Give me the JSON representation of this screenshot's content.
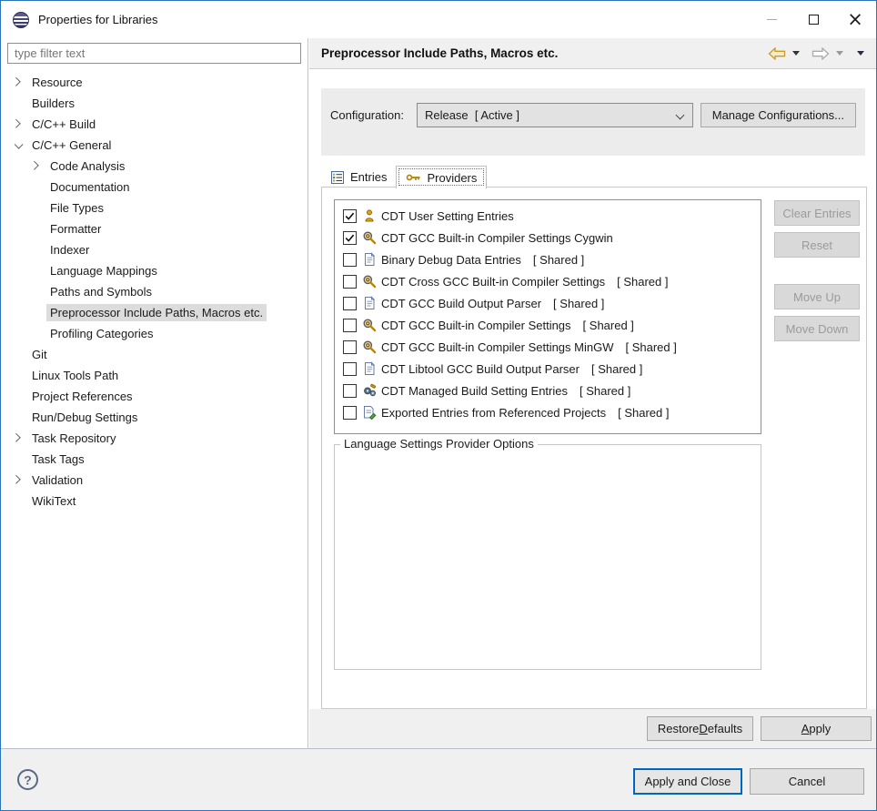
{
  "window": {
    "title": "Properties for Libraries"
  },
  "sidebar": {
    "filter_placeholder": "type filter text",
    "tree": [
      {
        "label": "Resource",
        "level": 0,
        "chevron": "collapsed",
        "selected": false
      },
      {
        "label": "Builders",
        "level": 0,
        "chevron": null,
        "selected": false
      },
      {
        "label": "C/C++ Build",
        "level": 0,
        "chevron": "collapsed",
        "selected": false
      },
      {
        "label": "C/C++ General",
        "level": 0,
        "chevron": "expanded",
        "selected": false
      },
      {
        "label": "Code Analysis",
        "level": 1,
        "chevron": "collapsed",
        "selected": false
      },
      {
        "label": "Documentation",
        "level": 1,
        "chevron": null,
        "selected": false
      },
      {
        "label": "File Types",
        "level": 1,
        "chevron": null,
        "selected": false
      },
      {
        "label": "Formatter",
        "level": 1,
        "chevron": null,
        "selected": false
      },
      {
        "label": "Indexer",
        "level": 1,
        "chevron": null,
        "selected": false
      },
      {
        "label": "Language Mappings",
        "level": 1,
        "chevron": null,
        "selected": false
      },
      {
        "label": "Paths and Symbols",
        "level": 1,
        "chevron": null,
        "selected": false
      },
      {
        "label": "Preprocessor Include Paths, Macros etc.",
        "level": 1,
        "chevron": null,
        "selected": true
      },
      {
        "label": "Profiling Categories",
        "level": 1,
        "chevron": null,
        "selected": false
      },
      {
        "label": "Git",
        "level": 0,
        "chevron": null,
        "selected": false
      },
      {
        "label": "Linux Tools Path",
        "level": 0,
        "chevron": null,
        "selected": false
      },
      {
        "label": "Project References",
        "level": 0,
        "chevron": null,
        "selected": false
      },
      {
        "label": "Run/Debug Settings",
        "level": 0,
        "chevron": null,
        "selected": false
      },
      {
        "label": "Task Repository",
        "level": 0,
        "chevron": "collapsed",
        "selected": false
      },
      {
        "label": "Task Tags",
        "level": 0,
        "chevron": null,
        "selected": false
      },
      {
        "label": "Validation",
        "level": 0,
        "chevron": "collapsed",
        "selected": false
      },
      {
        "label": "WikiText",
        "level": 0,
        "chevron": null,
        "selected": false
      }
    ]
  },
  "header": {
    "title": "Preprocessor Include Paths, Macros etc."
  },
  "configuration": {
    "label": "Configuration:",
    "value": "Release  [ Active ]",
    "manage_button": "Manage Configurations..."
  },
  "tabs": [
    {
      "label": "Entries",
      "active": false
    },
    {
      "label": "Providers",
      "active": true
    }
  ],
  "providers": {
    "shared_suffix": "[ Shared ]",
    "items": [
      {
        "label": "CDT User Setting Entries",
        "icon": "user",
        "checked": true,
        "shared": false
      },
      {
        "label": "CDT GCC Built-in Compiler Settings Cygwin",
        "icon": "magnifier",
        "checked": true,
        "shared": false
      },
      {
        "label": "Binary Debug Data Entries",
        "icon": "document",
        "checked": false,
        "shared": true
      },
      {
        "label": "CDT Cross GCC Built-in Compiler Settings",
        "icon": "magnifier",
        "checked": false,
        "shared": true
      },
      {
        "label": "CDT GCC Build Output Parser",
        "icon": "document",
        "checked": false,
        "shared": true
      },
      {
        "label": "CDT GCC Built-in Compiler Settings",
        "icon": "magnifier",
        "checked": false,
        "shared": true
      },
      {
        "label": "CDT GCC Built-in Compiler Settings MinGW",
        "icon": "magnifier",
        "checked": false,
        "shared": true
      },
      {
        "label": "CDT Libtool GCC Build Output Parser",
        "icon": "document",
        "checked": false,
        "shared": true
      },
      {
        "label": "CDT Managed Build Setting Entries",
        "icon": "gears",
        "checked": false,
        "shared": true
      },
      {
        "label": "Exported Entries from Referenced Projects",
        "icon": "doc-export",
        "checked": false,
        "shared": true
      }
    ],
    "side_buttons": [
      {
        "label": "Clear Entries",
        "enabled": false,
        "gap_before": false
      },
      {
        "label": "Reset",
        "enabled": false,
        "gap_before": false
      },
      {
        "label": "Move Up",
        "enabled": false,
        "gap_before": true
      },
      {
        "label": "Move Down",
        "enabled": false,
        "gap_before": false
      }
    ]
  },
  "options_group": {
    "title": "Language Settings Provider Options"
  },
  "footer": {
    "restore_defaults": {
      "pre": "Restore ",
      "mnemonic": "D",
      "post": "efaults"
    },
    "apply": {
      "pre": "",
      "mnemonic": "A",
      "post": "pply"
    },
    "apply_and_close": "Apply and Close",
    "cancel": "Cancel",
    "help": "?"
  },
  "colors": {
    "accent": "#0067c0",
    "window_border": "#2b74b8",
    "selection_bg": "#dcdcdc",
    "header_bg": "#f0f0f0",
    "config_bg": "#ececec"
  }
}
